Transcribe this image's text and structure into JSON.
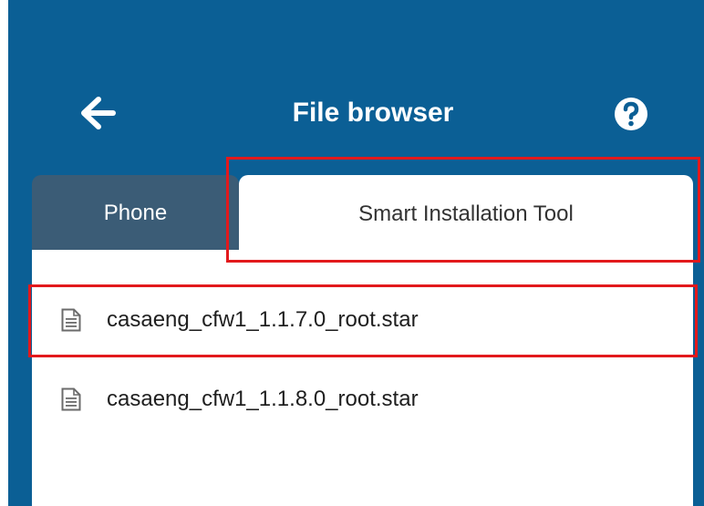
{
  "header": {
    "title": "File browser",
    "back_icon": "arrow-left-icon",
    "help_icon": "question-circle-icon"
  },
  "tabs": [
    {
      "label": "Phone",
      "active": false
    },
    {
      "label": "Smart Installation Tool",
      "active": true
    }
  ],
  "files": [
    {
      "name": "casaeng_cfw1_1.1.7.0_root.star",
      "icon": "document-icon",
      "highlighted": true
    },
    {
      "name": "casaeng_cfw1_1.1.8.0_root.star",
      "icon": "document-icon",
      "highlighted": false
    }
  ],
  "colors": {
    "header_bg": "#0b5f95",
    "inactive_tab": "#3b5c76",
    "highlight": "#e2191c"
  }
}
